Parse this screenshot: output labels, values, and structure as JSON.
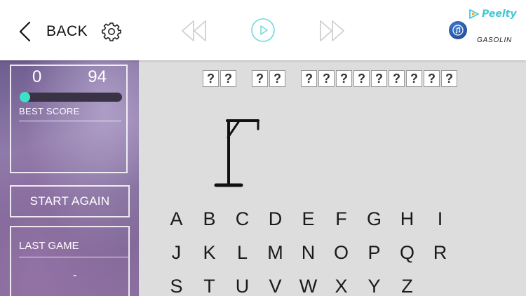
{
  "header": {
    "back_label": "BACK",
    "brand_name": "Peelty",
    "source_label": "GASOLIN",
    "icons": {
      "back": "chevron-left-icon",
      "settings": "gear-icon",
      "rewind": "rewind-icon",
      "play": "play-icon",
      "forward": "fast-forward-icon",
      "music": "music-note-icon",
      "brand": "peelty-logo"
    },
    "colors": {
      "media_inactive": "#d0d0d0",
      "play_accent": "#6ed9d9",
      "brand": "#43c7d6"
    }
  },
  "sidebar": {
    "score": {
      "current": "0",
      "best": "94",
      "progress_fraction": 0,
      "best_label": "BEST SCORE"
    },
    "start_again_label": "START AGAIN",
    "last_game": {
      "label": "LAST GAME",
      "value": "-"
    },
    "colors": {
      "progress_knob": "#3fe0c8",
      "progress_track": "#3a3346"
    }
  },
  "puzzle": {
    "hidden_glyph": "?",
    "words": [
      [
        "?",
        "?"
      ],
      [
        "?",
        "?"
      ],
      [
        "?",
        "?",
        "?",
        "?",
        "?",
        "?",
        "?",
        "?",
        "?"
      ]
    ]
  },
  "hangman": {
    "stage": "gallows"
  },
  "keyboard": {
    "rows": [
      [
        "A",
        "B",
        "C",
        "D",
        "E",
        "F",
        "G",
        "H",
        "I"
      ],
      [
        "J",
        "K",
        "L",
        "M",
        "N",
        "O",
        "P",
        "Q",
        "R"
      ],
      [
        "S",
        "T",
        "U",
        "V",
        "W",
        "X",
        "Y",
        "Z"
      ]
    ]
  }
}
